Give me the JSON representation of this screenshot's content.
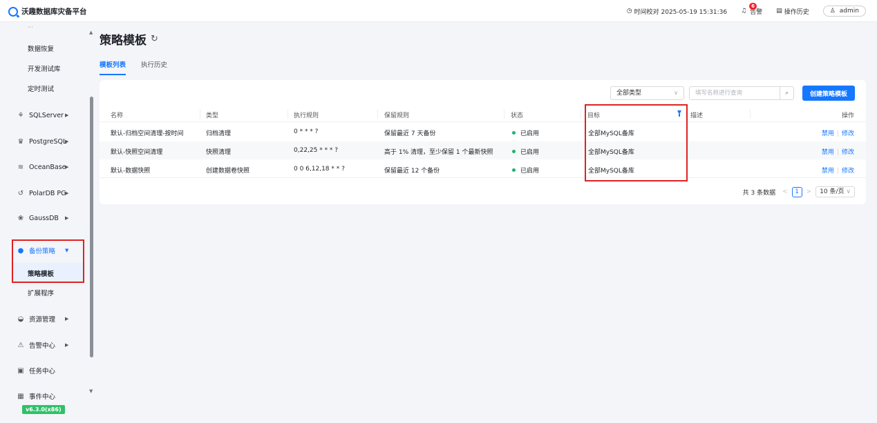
{
  "app": {
    "title": "沃趣数据库灾备平台",
    "time_label": "时间校对 2025-05-19 15:31:36",
    "alerts_label": "告警",
    "alerts_count": "6",
    "history_label": "操作历史",
    "user": "admin"
  },
  "sidebar": {
    "sub_top": [
      "数据恢复",
      "开发测试库",
      "定时测试"
    ],
    "groups": [
      {
        "label": "SQLServer",
        "icon": "sqlserver-icon"
      },
      {
        "label": "PostgreSQL",
        "icon": "postgresql-icon"
      },
      {
        "label": "OceanBase",
        "icon": "oceanbase-icon"
      },
      {
        "label": "PolarDB PG",
        "icon": "polardb-icon"
      },
      {
        "label": "GaussDB",
        "icon": "gaussdb-icon"
      }
    ],
    "active_group": "备份策略",
    "active_sub": "策略模板",
    "sub_after": "扩展程序",
    "bottom": [
      {
        "label": "资源管理",
        "icon": "resource-icon"
      },
      {
        "label": "告警中心",
        "icon": "alarm-icon"
      },
      {
        "label": "任务中心",
        "icon": "task-icon"
      },
      {
        "label": "事件中心",
        "icon": "event-icon"
      }
    ],
    "version": "v6.3.0(x86)"
  },
  "page": {
    "title": "策略模板",
    "tabs": [
      "模板列表",
      "执行历史"
    ]
  },
  "toolbar": {
    "type_select": "全部类型",
    "search_placeholder": "填写名称进行查询",
    "create_label": "创建策略模板"
  },
  "table": {
    "headers": [
      "名称",
      "类型",
      "执行规则",
      "保留规则",
      "状态",
      "目标",
      "描述",
      "操作"
    ],
    "rows": [
      {
        "name": "默认-归档空间清理-按时间",
        "type": "归档清理",
        "exec": "0 * * * ?",
        "retain": "保留最近 7 天备份",
        "status": "已启用",
        "target": "全部MySQL备库",
        "desc": "",
        "act1": "禁用",
        "act2": "修改"
      },
      {
        "name": "默认-快照空间清理",
        "type": "快照清理",
        "exec": "0,22,25 * * * ?",
        "retain": "高于 1% 清理，至少保留 1 个最新快照",
        "status": "已启用",
        "target": "全部MySQL备库",
        "desc": "",
        "act1": "禁用",
        "act2": "修改"
      },
      {
        "name": "默认-数据快照",
        "type": "创建数据卷快照",
        "exec": "0 0 6,12,18 * * ?",
        "retain": "保留最近 12 个备份",
        "status": "已启用",
        "target": "全部MySQL备库",
        "desc": "",
        "act1": "禁用",
        "act2": "修改"
      }
    ]
  },
  "pager": {
    "total": "共 3 条数据",
    "page": "1",
    "size": "10 条/页"
  },
  "colors": {
    "accent": "#1677ff",
    "highlight": "#e02020",
    "status_ok": "#1ab46c"
  }
}
